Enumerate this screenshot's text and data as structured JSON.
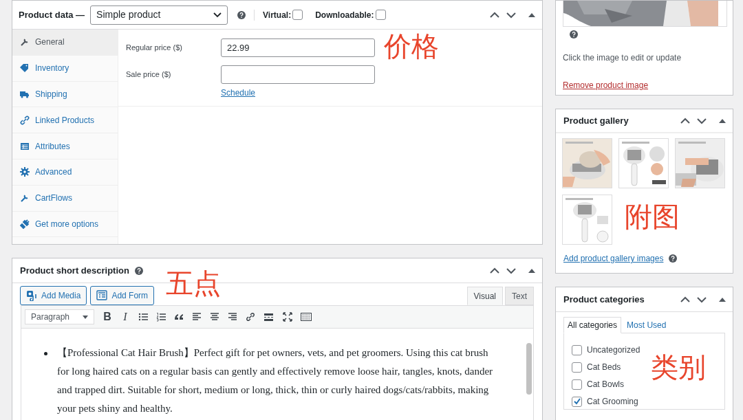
{
  "product_data": {
    "title": "Product data —",
    "product_type": "Simple product",
    "virtual": {
      "label": "Virtual:",
      "checked": false
    },
    "downloadable": {
      "label": "Downloadable:",
      "checked": false
    },
    "tabs": [
      {
        "label": "General",
        "kind": "wrench",
        "selected": true
      },
      {
        "label": "Inventory",
        "kind": "tag",
        "selected": false
      },
      {
        "label": "Shipping",
        "kind": "truck",
        "selected": false
      },
      {
        "label": "Linked Products",
        "kind": "link",
        "selected": false
      },
      {
        "label": "Attributes",
        "kind": "table",
        "selected": false
      },
      {
        "label": "Advanced",
        "kind": "gear",
        "selected": false
      },
      {
        "label": "CartFlows",
        "kind": "wrench",
        "selected": false
      },
      {
        "label": "Get more options",
        "kind": "plug",
        "selected": false
      }
    ],
    "fields": [
      {
        "label": "Regular price ($)",
        "value": "22.99"
      },
      {
        "label": "Sale price ($)"
      }
    ],
    "schedule_link": "Schedule",
    "annotation": "价格"
  },
  "short_description": {
    "title": "Product short description",
    "buttons": [
      {
        "label": "Add Media",
        "kind": "media"
      },
      {
        "label": "Add Form",
        "kind": "form"
      }
    ],
    "editor_tabs": [
      {
        "label": "Visual",
        "selected": true
      },
      {
        "label": "Text",
        "selected": false
      }
    ],
    "format": "Paragraph",
    "toolbar": [
      {
        "kind": "glyph",
        "text": "B"
      },
      {
        "kind": "glyph",
        "text": "I"
      },
      {
        "kind": "bullet-list"
      },
      {
        "kind": "numbered-list"
      },
      {
        "kind": "quote"
      },
      {
        "kind": "align-left"
      },
      {
        "kind": "align-center"
      },
      {
        "kind": "align-right"
      },
      {
        "kind": "link"
      },
      {
        "kind": "more"
      },
      {
        "kind": "fullscreen"
      },
      {
        "kind": "toolbar-toggle"
      }
    ],
    "content": [
      "【Professional Cat Hair Brush】Perfect gift for pet owners, vets, and pet groomers. Using this cat brush for long haired cats on a regular basis can gently and effectively remove loose hair, tangles, knots, dander and trapped dirt. Suitable for short, medium or long, thick, thin or curly haired dogs/cats/rabbits, making your pets shiny and healthy."
    ],
    "annotation": "五点"
  },
  "product_image": {
    "hint": "Click the image to edit or update",
    "remove_link": "Remove product image"
  },
  "product_gallery": {
    "title": "Product gallery",
    "add_link": "Add product gallery images",
    "annotation": "附图"
  },
  "product_categories": {
    "title": "Product categories",
    "tabs": [
      {
        "label": "All categories",
        "selected": true
      },
      {
        "label": "Most Used",
        "selected": false
      }
    ],
    "items": [
      {
        "label": "Uncategorized",
        "checked": false
      },
      {
        "label": "Cat Beds",
        "checked": false
      },
      {
        "label": "Cat Bowls",
        "checked": false
      },
      {
        "label": "Cat Grooming",
        "checked": true
      }
    ],
    "annotation": "类别"
  }
}
